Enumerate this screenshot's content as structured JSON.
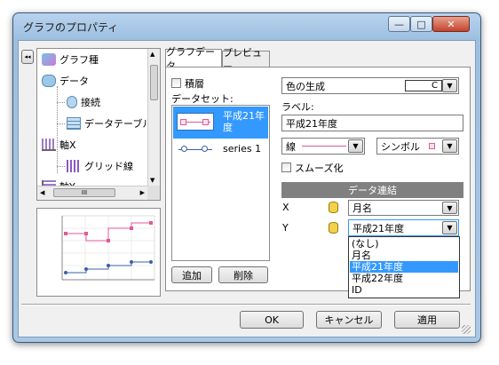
{
  "window": {
    "title": "グラフのプロパティ",
    "min_glyph": "—",
    "max_glyph": "□",
    "close_glyph": "✕"
  },
  "tree": {
    "collapse_glyph": "◂◂",
    "items": [
      {
        "label": "グラフ種",
        "icon": "chart-type-icon"
      },
      {
        "label": "データ",
        "icon": "data-icon"
      },
      {
        "label": "接続",
        "icon": "connection-icon"
      },
      {
        "label": "データテーブル",
        "icon": "data-table-icon"
      },
      {
        "label": "軸X",
        "icon": "axis-x-icon"
      },
      {
        "label": "グリッド線",
        "icon": "gridline-icon"
      },
      {
        "label": "軸Y",
        "icon": "axis-y-icon"
      }
    ],
    "hscroll_thumb": "III"
  },
  "tabs": [
    {
      "label": "グラフデータ",
      "active": true
    },
    {
      "label": "プレビュー",
      "active": false
    }
  ],
  "stack": {
    "label": "積層",
    "checked": false
  },
  "dataset": {
    "label": "データセット:",
    "items": [
      {
        "label": "平成21年度",
        "selected": true,
        "line_color": "#e05a9a"
      },
      {
        "label": "series 1",
        "selected": false,
        "line_color": "#3a5fa8"
      }
    ],
    "add_label": "追加",
    "delete_label": "削除"
  },
  "color_gen": {
    "label": "色の生成",
    "value": "C"
  },
  "label_field": {
    "caption": "ラベル:",
    "value": "平成21年度"
  },
  "line_select": {
    "label": "線"
  },
  "symbol_select": {
    "label": "シンボル"
  },
  "smooth": {
    "label": "スムーズ化",
    "checked": false
  },
  "data_link": {
    "header": "データ連結",
    "rows": [
      {
        "axis": "X",
        "value": "月名"
      },
      {
        "axis": "Y",
        "value": "平成21年度"
      }
    ],
    "dropdown_options": [
      {
        "label": "(なし)",
        "selected": false
      },
      {
        "label": "月名",
        "selected": false
      },
      {
        "label": "平成21年度",
        "selected": true
      },
      {
        "label": "平成22年度",
        "selected": false
      },
      {
        "label": "ID",
        "selected": false
      }
    ]
  },
  "footer": {
    "ok": "OK",
    "cancel": "キャンセル",
    "apply": "適用"
  },
  "colors": {
    "selection": "#3399ff",
    "header_bg": "#808080",
    "pink": "#e05a9a",
    "blue": "#3a5fa8"
  }
}
